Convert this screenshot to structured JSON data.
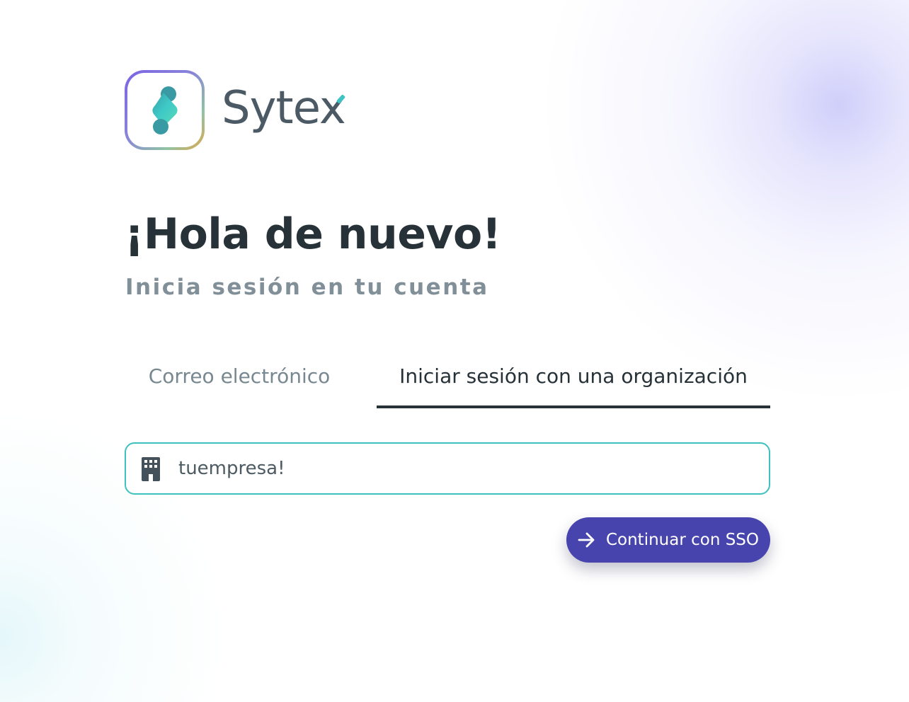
{
  "brand": {
    "name": "Sytex",
    "logo_icon": "sytex-s-logo-icon",
    "colors": {
      "gradient": [
        "#7a63e6",
        "#8fc3a4",
        "#e1a74c"
      ],
      "mark_teal": "#3ec2c4",
      "wordmark": "#4b5a64"
    }
  },
  "header": {
    "title": "¡Hola de nuevo!",
    "subtitle": "Inicia sesión en tu cuenta"
  },
  "tabs": [
    {
      "label": "Correo electrónico",
      "active": false
    },
    {
      "label": "Iniciar sesión con una organización",
      "active": true
    }
  ],
  "org_field": {
    "icon": "building-icon",
    "value": "tuempresa!",
    "border_color": "#3fc1bf"
  },
  "sso_button": {
    "icon": "arrow-right-icon",
    "label": "Continuar con SSO",
    "color": "#4745ad"
  }
}
